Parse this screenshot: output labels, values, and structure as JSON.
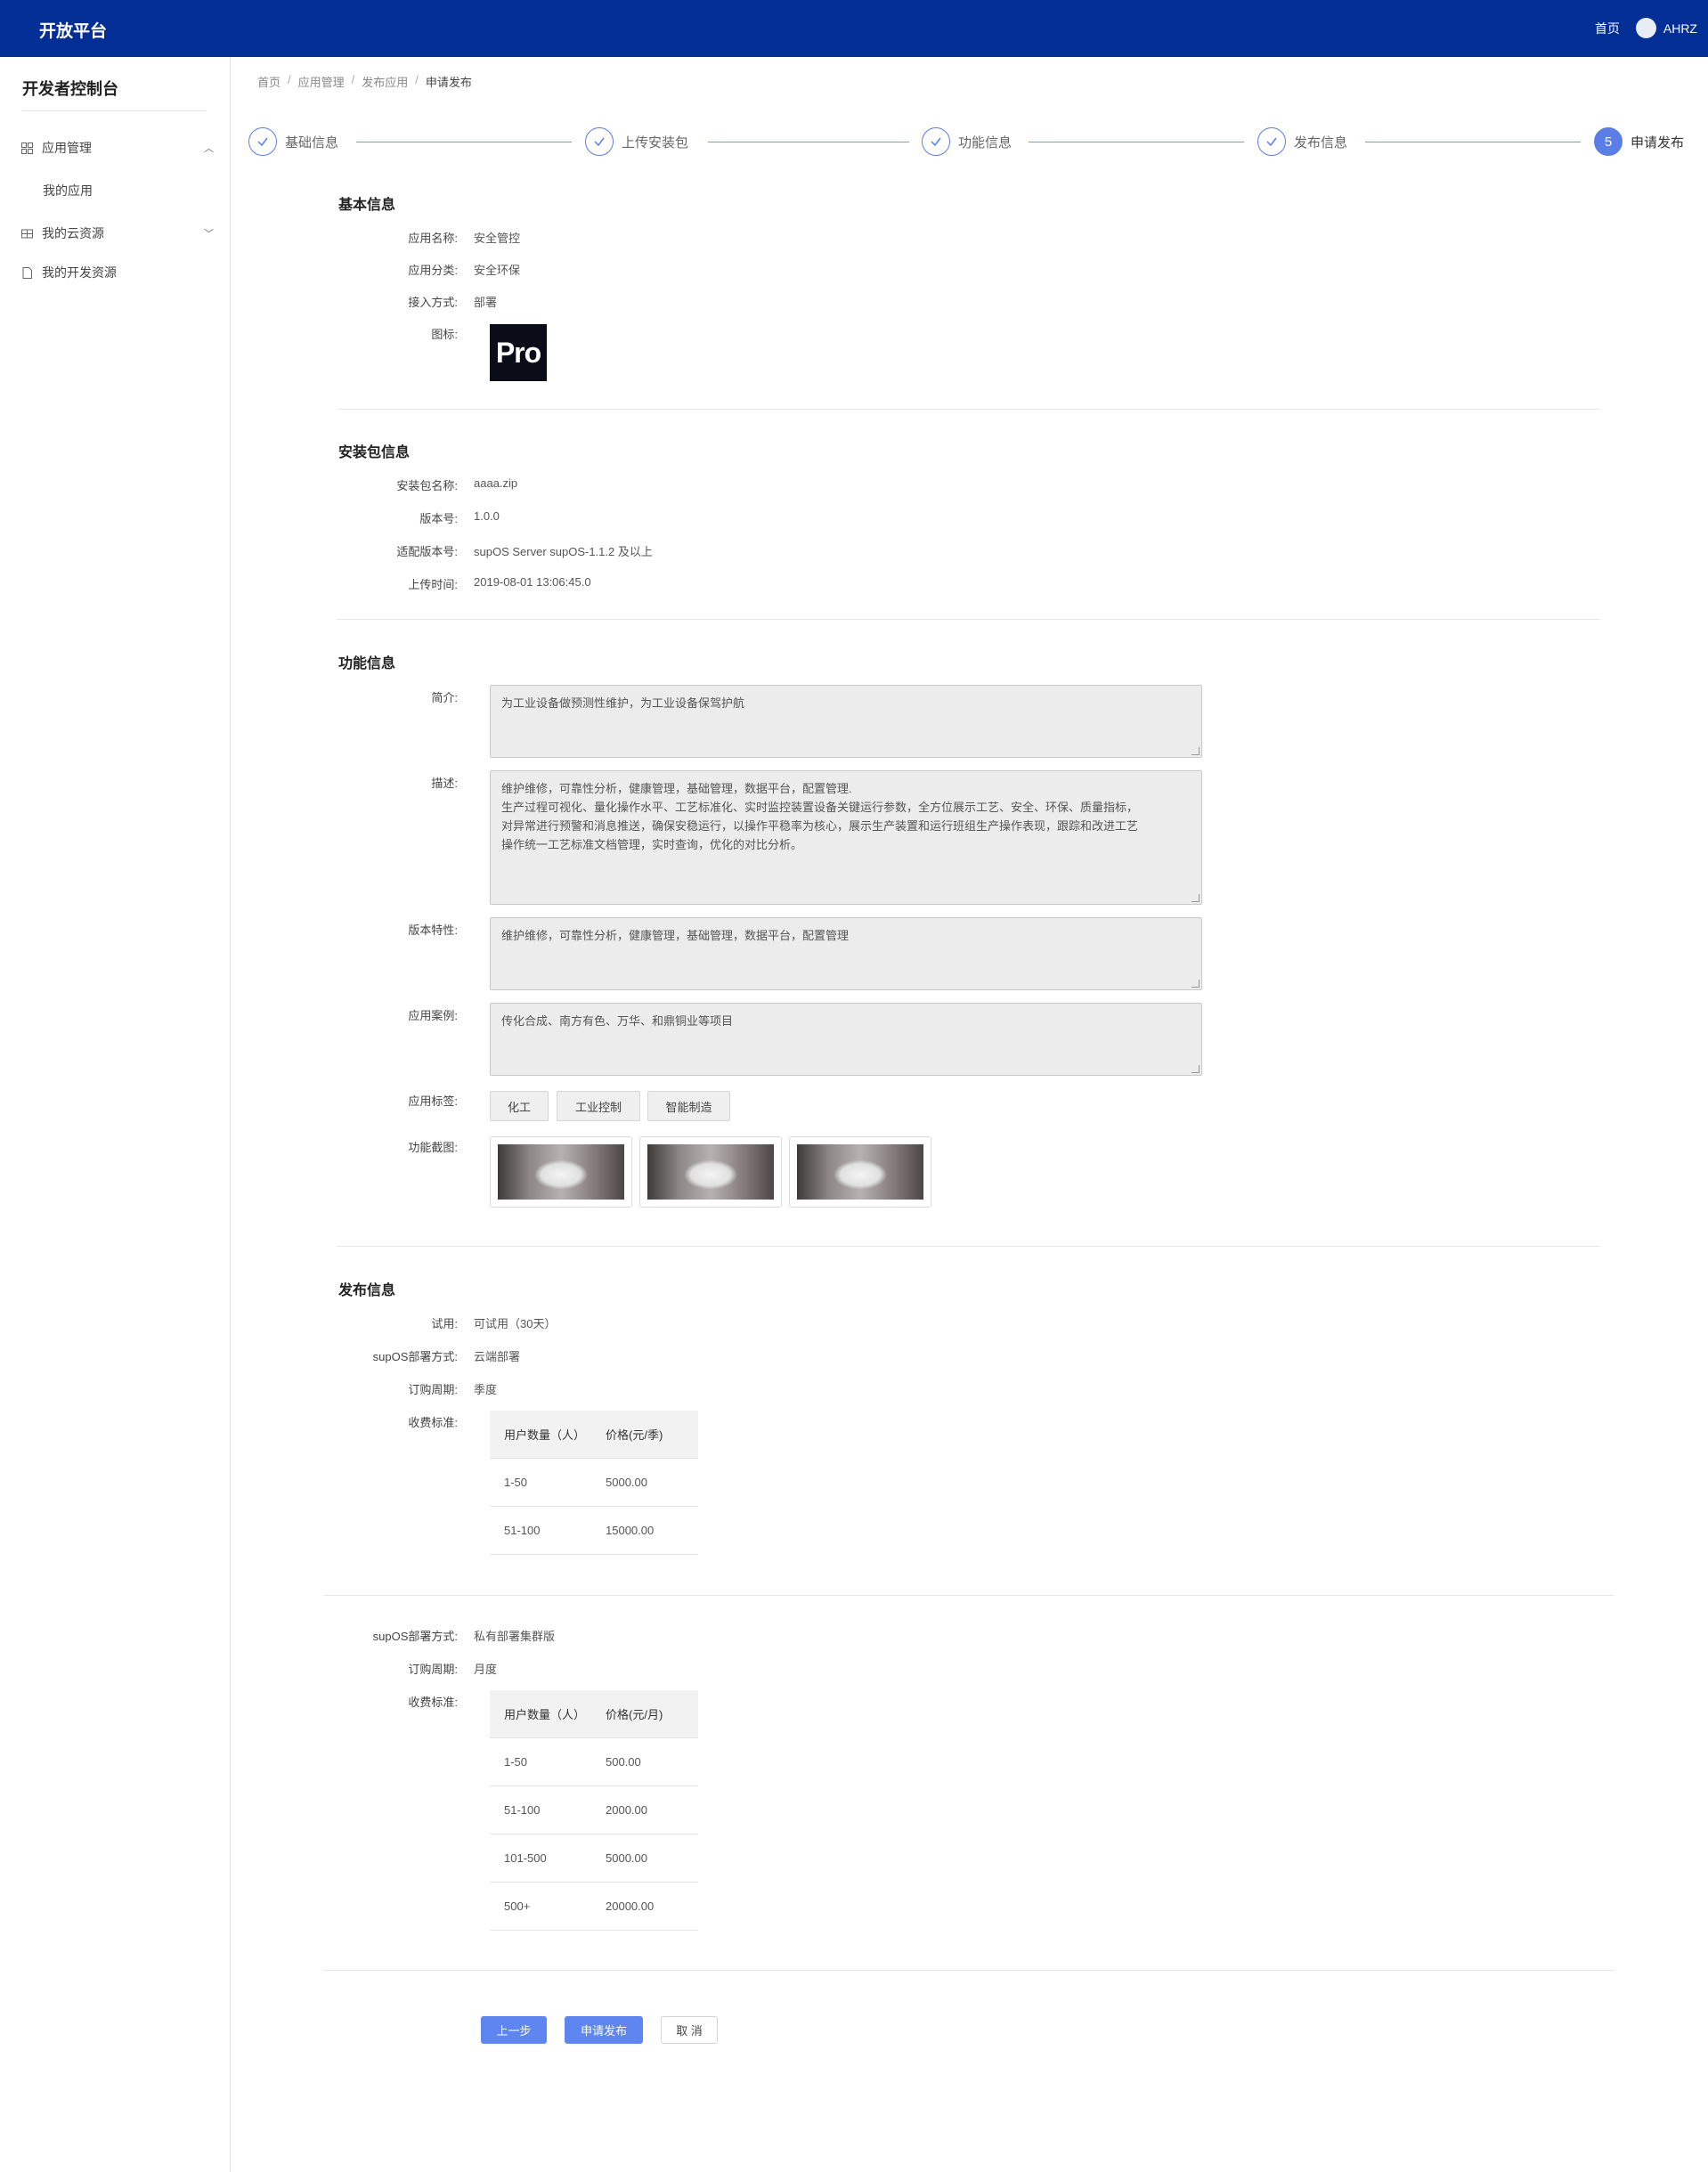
{
  "header": {
    "brand": "开放平台",
    "home": "首页",
    "user": "AHRZ"
  },
  "sidebar": {
    "title": "开发者控制台",
    "items": [
      {
        "label": "应用管理"
      },
      {
        "label": "我的应用"
      },
      {
        "label": "我的云资源"
      },
      {
        "label": "我的开发资源"
      }
    ]
  },
  "breadcrumb": [
    "首页",
    "应用管理",
    "发布应用",
    "申请发布"
  ],
  "steps": [
    {
      "label": "基础信息",
      "state": "done"
    },
    {
      "label": "上传安装包",
      "state": "done"
    },
    {
      "label": "功能信息",
      "state": "done"
    },
    {
      "label": "发布信息",
      "state": "done"
    },
    {
      "label": "申请发布",
      "num": "5",
      "state": "active"
    }
  ],
  "basic": {
    "title": "基本信息",
    "name_k": "应用名称:",
    "name_v": "安全管控",
    "category_k": "应用分类:",
    "category_v": "安全环保",
    "access_k": "接入方式:",
    "access_v": "部署",
    "icon_k": "图标:",
    "icon_text": "Pro"
  },
  "package": {
    "title": "安装包信息",
    "pkg_k": "安装包名称:",
    "pkg_v": "aaaa.zip",
    "ver_k": "版本号:",
    "ver_v": "1.0.0",
    "compat_k": "适配版本号:",
    "compat_v": "supOS Server supOS-1.1.2 及以上",
    "time_k": "上传时间:",
    "time_v": "2019-08-01 13:06:45.0"
  },
  "feature": {
    "title": "功能信息",
    "intro_k": "简介:",
    "intro_v": "为工业设备做预测性维护，为工业设备保驾护航",
    "desc_k": "描述:",
    "desc_v": "维护维修，可靠性分析，健康管理，基础管理，数据平台，配置管理.\n生产过程可视化、量化操作水平、工艺标准化、实时监控装置设备关键运行参数，全方位展示工艺、安全、环保、质量指标，\n对异常进行预警和消息推送，确保安稳运行，以操作平稳率为核心，展示生产装置和运行班组生产操作表现，跟踪和改进工艺\n操作统一工艺标准文档管理，实时查询，优化的对比分析。",
    "features_k": "版本特性:",
    "features_v": "维护维修，可靠性分析，健康管理，基础管理，数据平台，配置管理",
    "cases_k": "应用案例:",
    "cases_v": "传化合成、南方有色、万华、和鼎铜业等项目",
    "tags_k": "应用标签:",
    "tags": [
      "化工",
      "工业控制",
      "智能制造"
    ],
    "shots_k": "功能截图:"
  },
  "publish": {
    "title": "发布信息",
    "trial_k": "试用:",
    "trial_v": "可试用（30天）",
    "plans": [
      {
        "deploy_k": "supOS部署方式:",
        "deploy_v": "云端部署",
        "cycle_k": "订购周期:",
        "cycle_v": "季度",
        "fee_k": "收费标准:",
        "headers": [
          "用户数量（人）",
          "价格(元/季)"
        ],
        "rows": [
          [
            "1-50",
            "5000.00"
          ],
          [
            "51-100",
            "15000.00"
          ]
        ]
      },
      {
        "deploy_k": "supOS部署方式:",
        "deploy_v": "私有部署集群版",
        "cycle_k": "订购周期:",
        "cycle_v": "月度",
        "fee_k": "收费标准:",
        "headers": [
          "用户数量（人）",
          "价格(元/月)"
        ],
        "rows": [
          [
            "1-50",
            "500.00"
          ],
          [
            "51-100",
            "2000.00"
          ],
          [
            "101-500",
            "5000.00"
          ],
          [
            "500+",
            "20000.00"
          ]
        ]
      }
    ]
  },
  "buttons": {
    "prev": "上一步",
    "submit": "申请发布",
    "cancel": "取 消"
  },
  "colors": {
    "topbar": "#022e95",
    "accent": "#5b7de6",
    "button": "#5f86f0"
  },
  "icons": {
    "app_mgmt": "grid-icon",
    "cloud": "server-icon",
    "dev": "file-icon",
    "step_done": "check-icon"
  }
}
